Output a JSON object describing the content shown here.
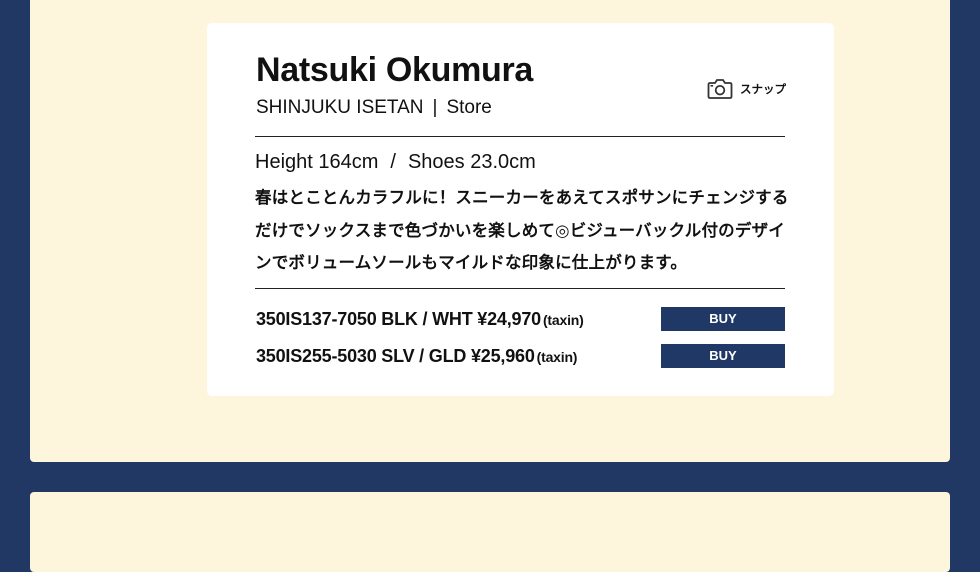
{
  "colors": {
    "background": "#213865",
    "panel": "#fdf6dc",
    "card": "#ffffff",
    "button": "#1f3865",
    "button_text": "#ffffff"
  },
  "staff": {
    "name": "Natsuki Okumura",
    "store": "SHINJUKU ISETAN",
    "separator": "|",
    "store_label": "Store"
  },
  "snap": {
    "icon": "camera-icon",
    "label": "スナップ"
  },
  "measurements": {
    "height": "Height 164cm",
    "slash": "/",
    "shoes": "Shoes 23.0cm"
  },
  "description": "春はとことんカラフルに！スニーカーをあえてスポサンにチェンジするだけでソックスまで色づかいを楽しめて◎ビジューバックル付のデザインでボリュームソールもマイルドな印象に仕上がります。",
  "products": [
    {
      "text": "350IS137-7050 BLK / WHT ¥24,970",
      "tax": "(taxin)",
      "button": "BUY"
    },
    {
      "text": "350IS255-5030 SLV / GLD ¥25,960",
      "tax": "(taxin)",
      "button": "BUY"
    }
  ]
}
